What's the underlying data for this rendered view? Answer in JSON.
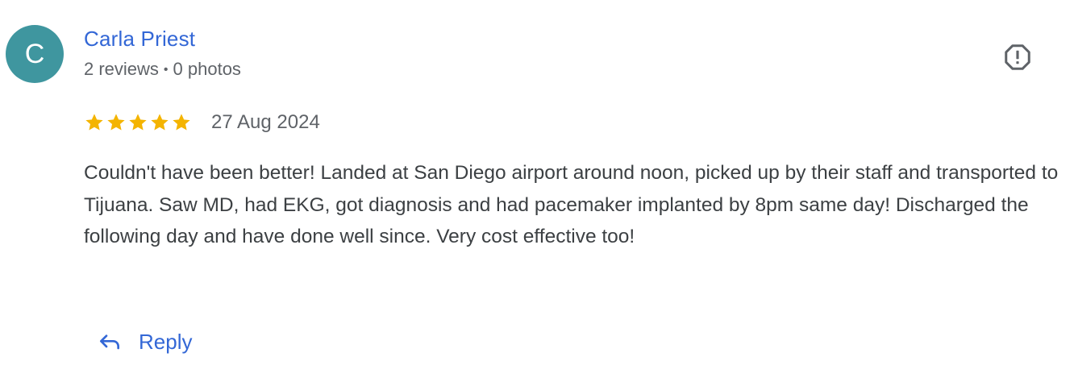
{
  "review": {
    "author": {
      "avatar_letter": "C",
      "avatar_color": "#3f969f",
      "name": "Carla Priest",
      "reviews_count": "2 reviews",
      "separator": "•",
      "photos_count": "0 photos"
    },
    "report_icon": "report-flag-icon",
    "rating": {
      "stars": 5,
      "max_stars": 5,
      "star_color": "#f4b400"
    },
    "date": "27 Aug 2024",
    "text": "Couldn't have been better! Landed at San Diego airport around noon, picked up by their staff and transported to Tijuana. Saw MD, had EKG, got diagnosis and had pacemaker implanted by 8pm same day! Discharged the following day and have done well since. Very cost effective too!",
    "reply": {
      "label": "Reply",
      "icon": "reply-arrow-icon"
    },
    "accent_color": "#3367d6"
  }
}
